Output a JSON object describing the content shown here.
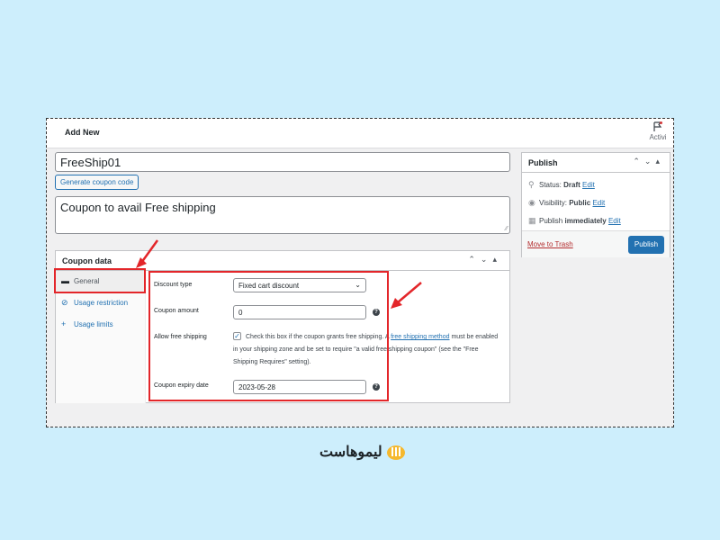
{
  "header": {
    "title": "Add New",
    "activity_label": "Activi"
  },
  "coupon": {
    "code_value": "FreeShip01",
    "generate_label": "Generate coupon code",
    "description": "Coupon to avail Free shipping"
  },
  "coupon_data": {
    "title": "Coupon data",
    "tabs": [
      {
        "label": "General",
        "icon": "ticket-icon"
      },
      {
        "label": "Usage restriction",
        "icon": "block-icon"
      },
      {
        "label": "Usage limits",
        "icon": "plus-icon"
      }
    ],
    "fields": {
      "discount_type_label": "Discount type",
      "discount_type_value": "Fixed cart discount",
      "amount_label": "Coupon amount",
      "amount_value": "0",
      "free_shipping_label": "Allow free shipping",
      "free_shipping_text_before": "Check this box if the coupon grants free shipping. A ",
      "free_shipping_link": "free shipping method",
      "free_shipping_text_after": " must be enabled in your shipping zone and be set to require \"a valid free shipping coupon\" (see the \"Free Shipping Requires\" setting).",
      "expiry_label": "Coupon expiry date",
      "expiry_value": "2023-05-28"
    }
  },
  "publish": {
    "title": "Publish",
    "status_label": "Status:",
    "status_value": "Draft",
    "visibility_label": "Visibility:",
    "visibility_value": "Public",
    "schedule_label": "Publish",
    "schedule_value": "immediately",
    "edit_label": "Edit",
    "trash_label": "Move to Trash",
    "publish_button": "Publish"
  },
  "brand": {
    "name": "لیموهاست"
  },
  "colors": {
    "accent": "#2271b1",
    "highlight": "#e3262a",
    "background": "#cdeefc"
  }
}
